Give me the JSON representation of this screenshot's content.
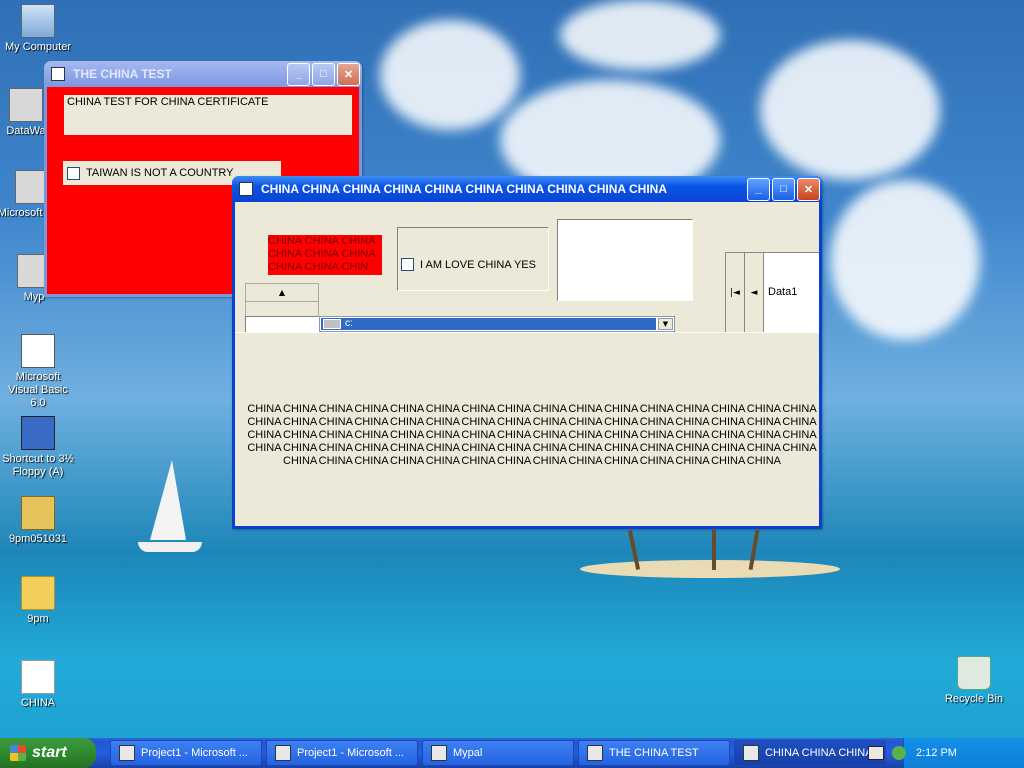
{
  "desktop": {
    "icons": [
      {
        "label": "My Computer"
      },
      {
        "label": "DataWa"
      },
      {
        "label": "Microsoft C++"
      },
      {
        "label": "Myp"
      },
      {
        "label": "Microsoft Visual Basic 6.0"
      },
      {
        "label": "Shortcut to 3½ Floppy (A)"
      },
      {
        "label": "9pm051031"
      },
      {
        "label": "9pm"
      },
      {
        "label": "CHINA"
      },
      {
        "label": "Recycle Bin"
      }
    ]
  },
  "window_test": {
    "title": "THE CHINA TEST",
    "header_label": "CHINA TEST FOR CHINA CERTIFICATE",
    "checkbox_label": "TAIWAN IS NOT A COUNTRY",
    "checkbox_checked": false,
    "background_color": "#ff0000"
  },
  "window_china": {
    "title": "CHINA CHINA CHINA CHINA CHINA CHINA CHINA CHINA CHINA CHINA",
    "red_label": "CHINA CHINA CHINA CHINA CHINA CHINA CHINA CHINA CHIN",
    "checkbox_label": "I AM LOVE CHINA YES",
    "checkbox_checked": false,
    "spin_up_arrow": "▲",
    "drive_combo_value": "c:",
    "data_control_label": "Data1",
    "nav_first": "|◄",
    "nav_prev": "◄",
    "big_text": "CHINA CHINA CHINA CHINA CHINA CHINA CHINA CHINA CHINA CHINA CHINA CHINA CHINA CHINA CHINA CHINA CHINA CHINA CHINA CHINA CHINA CHINA CHINA CHINA CHINA CHINA CHINA CHINA CHINA CHINA CHINA CHINA CHINA CHINA CHINA CHINA CHINA CHINA CHINA CHINA CHINA CHINA CHINA CHINA CHINA CHINA CHINA CHINA CHINA CHINA CHINA CHINA CHINA CHINA CHINA CHINA CHINA CHINA CHINA CHINA CHINA CHINA CHINA CHINA CHINA CHINA CHINA CHINA CHINA CHINA CHINA CHINA CHINA CHINA CHINA CHINA CHINA CHINA",
    "red_color": "#ff0000",
    "red_text_color": "#800000"
  },
  "taskbar": {
    "start_label": "start",
    "items": [
      {
        "label": "Project1 - Microsoft ..."
      },
      {
        "label": "Project1 - Microsoft ..."
      },
      {
        "label": "Mypal"
      },
      {
        "label": "THE CHINA TEST"
      },
      {
        "label": "CHINA CHINA CHINA..."
      }
    ],
    "clock": "2:12 PM"
  }
}
